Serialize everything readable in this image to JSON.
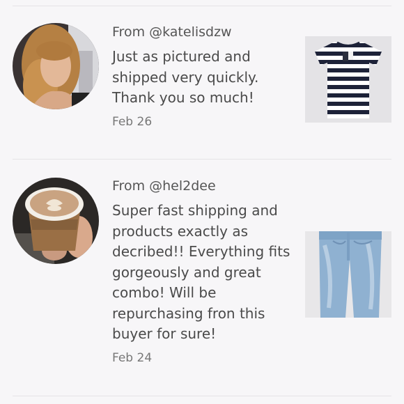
{
  "reviews": [
    {
      "from": "From @katelisdzw",
      "text": "Just as pictured and shipped very quickly. Thank you so much!",
      "date": "Feb 26",
      "avatar_icon": "user-avatar-photo",
      "product_icon": "striped-tshirt-photo"
    },
    {
      "from": "From @hel2dee",
      "text": "Super fast shipping and products exactly as decribed!! Everything fits gorgeously and great combo! Will be repurchasing fron this buyer for sure!",
      "date": "Feb 24",
      "avatar_icon": "coffee-cup-photo",
      "product_icon": "denim-jeans-photo"
    }
  ]
}
